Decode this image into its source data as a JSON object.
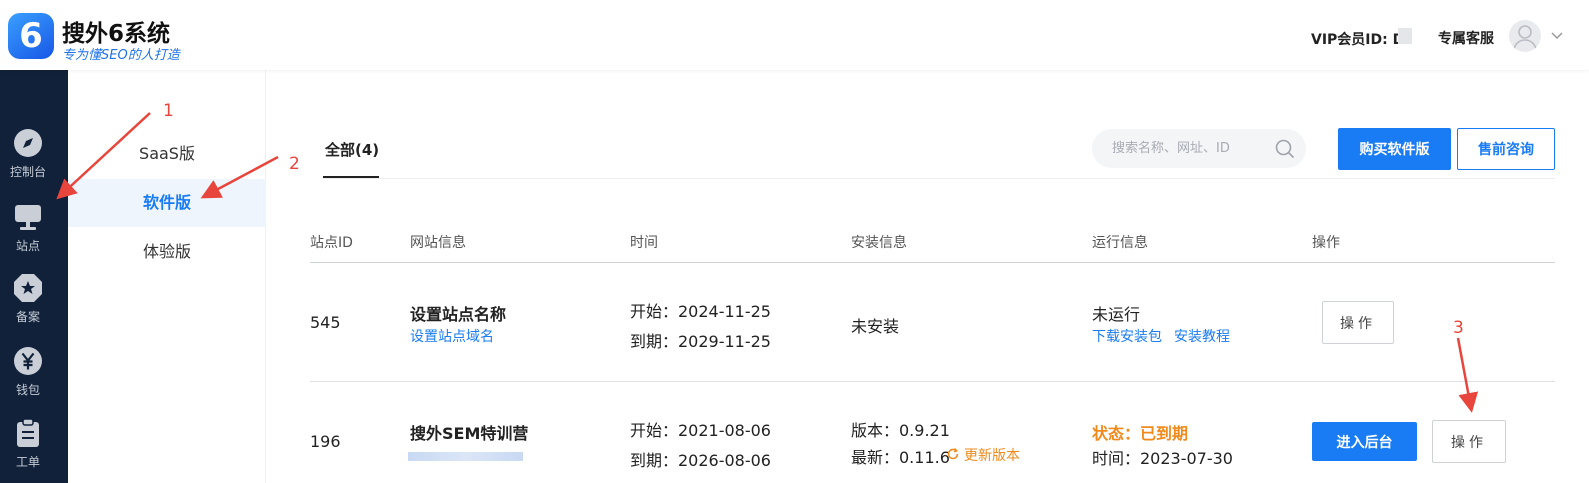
{
  "header": {
    "logo_number": "6",
    "app_title": "搜外6系统",
    "slogan": "专为懂SEO的人打造",
    "vip_label": "VIP会员ID: Dı",
    "support_label": "专属客服"
  },
  "nav": {
    "items": [
      {
        "label": "控制台",
        "icon": "compass-icon"
      },
      {
        "label": "站点",
        "icon": "monitor-icon"
      },
      {
        "label": "备案",
        "icon": "star-badge-icon"
      },
      {
        "label": "钱包",
        "icon": "yen-icon"
      },
      {
        "label": "工单",
        "icon": "clipboard-icon"
      }
    ]
  },
  "submenu": {
    "items": [
      {
        "label": "SaaS版",
        "active": false
      },
      {
        "label": "软件版",
        "active": true
      },
      {
        "label": "体验版",
        "active": false
      }
    ]
  },
  "main": {
    "tab_all": "全部(4)",
    "search_placeholder": "搜索名称、网址、ID",
    "buy_button": "购买软件版",
    "presale_button": "售前咨询",
    "columns": [
      "站点ID",
      "网站信息",
      "时间",
      "安装信息",
      "运行信息",
      "操作"
    ],
    "rows": [
      {
        "id": "545",
        "site_name": "设置站点名称",
        "site_domain_link": "设置站点域名",
        "start": "开始：2024-11-25",
        "expire": "到期：2029-11-25",
        "install": "未安装",
        "run_status": "未运行",
        "download_link": "下载安装包",
        "tutorial_link": "安装教程",
        "op_button": "操作"
      },
      {
        "id": "196",
        "site_name": "搜外SEM特训营",
        "start": "开始：2021-08-06",
        "expire": "到期：2026-08-06",
        "version": "版本：0.9.21",
        "latest": "最新：0.11.6",
        "update_link": "更新版本",
        "run_status": "状态：已到期",
        "run_time": "时间：2023-07-30",
        "enter_button": "进入后台",
        "op_button": "操作"
      }
    ]
  },
  "annotations": [
    "1",
    "2",
    "3"
  ],
  "colors": {
    "accent": "#1a7cf4",
    "nav_bg": "#11213a",
    "warning": "#f08a1c",
    "annotation": "#e8453c"
  }
}
